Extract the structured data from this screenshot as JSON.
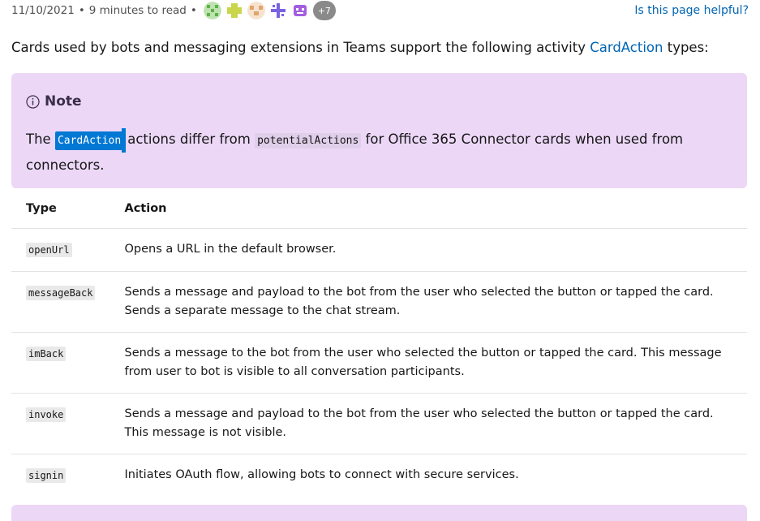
{
  "meta": {
    "date": "11/10/2021",
    "read_time": "9 minutes to read",
    "bullet": "•",
    "more_contributors": "+7",
    "helpful_link": "Is this page helpful?"
  },
  "contributors": [
    {
      "icon": "contributor-avatar",
      "color": "#bfe3b0"
    },
    {
      "icon": "contributor-avatar",
      "color": "#d6e58a"
    },
    {
      "icon": "contributor-avatar",
      "color": "#f1d3b4"
    },
    {
      "icon": "contributor-avatar",
      "color": "#b6a9ee"
    },
    {
      "icon": "contributor-avatar",
      "color": "#c89cec"
    }
  ],
  "intro": {
    "before": "Cards used by bots and messaging extensions in Teams support the following activity ",
    "link": "CardAction",
    "after": " types:"
  },
  "note": {
    "title": "Note",
    "icon": "info-icon",
    "text_before": "The ",
    "code_selected": "CardAction",
    "text_middle": "actions differ from ",
    "code": "potentialActions",
    "text_after": " for Office 365 Connector cards when used from connectors."
  },
  "table": {
    "headers": [
      "Type",
      "Action"
    ],
    "rows": [
      {
        "type": "openUrl",
        "action": "Opens a URL in the default browser."
      },
      {
        "type": "messageBack",
        "action": "Sends a message and payload to the bot from the user who selected the button or tapped the card. Sends a separate message to the chat stream."
      },
      {
        "type": "imBack",
        "action": "Sends a message to the bot from the user who selected the button or tapped the card. This message from user to bot is visible to all conversation participants."
      },
      {
        "type": "invoke",
        "action": "Sends a message and payload to the bot from the user who selected the button or tapped the card. This message is not visible."
      },
      {
        "type": "signin",
        "action": "Initiates OAuth flow, allowing bots to connect with secure services."
      }
    ]
  },
  "colors": {
    "link": "#0065b3",
    "note_background": "#ecd7f7",
    "selection": "#0078d4"
  }
}
